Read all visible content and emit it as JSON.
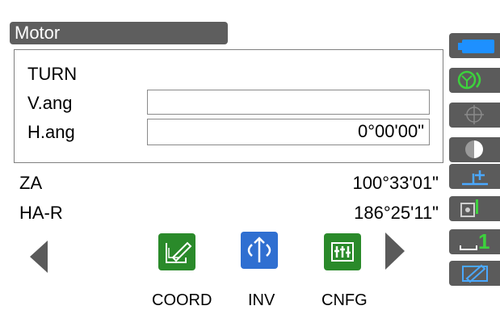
{
  "title": "Motor",
  "mode": "TURN",
  "fields": [
    {
      "label": "V.ang",
      "value": ""
    },
    {
      "label": "H.ang",
      "value": "0°00'00\""
    }
  ],
  "readings": [
    {
      "label": "ZA",
      "value": "100°33'01\""
    },
    {
      "label": "HA-R",
      "value": "186°25'11\""
    }
  ],
  "softkeys": [
    {
      "label": "COORD",
      "icon": "edit-pen-icon",
      "color": "#2a8a2a"
    },
    {
      "label": "INV",
      "icon": "rotate-arrows-icon",
      "color": "#2f6fd1"
    },
    {
      "label": "CNFG",
      "icon": "config-sliders-icon",
      "color": "#2a8a2a"
    }
  ],
  "side_icons": [
    "battery-icon",
    "target-icon",
    "crosshair-icon",
    "half-circle-icon",
    "plus-level-icon",
    "signal-device-icon",
    "page-one-icon",
    "pen-input-icon"
  ],
  "side_page_number": "1",
  "colors": {
    "titlebar": "#5e5e5e",
    "sidebar": "#5b5b5b",
    "battery": "#1e90ff",
    "green": "#2a8a2a",
    "blue": "#2f6fd1"
  }
}
